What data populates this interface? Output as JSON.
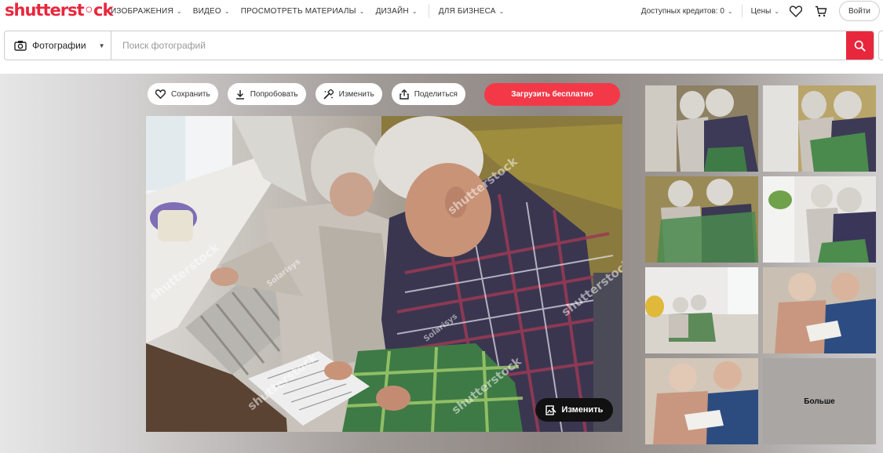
{
  "brand": {
    "logo_text": "shutterst◦ck",
    "accent": "#e8273d"
  },
  "nav": {
    "items": [
      {
        "label": "ИЗОБРАЖЕНИЯ"
      },
      {
        "label": "ВИДЕО"
      },
      {
        "label": "ПРОСМОТРЕТЬ МАТЕРИАЛЫ"
      },
      {
        "label": "ДИЗАЙН"
      },
      {
        "label": "ДЛЯ БИЗНЕСА"
      }
    ],
    "credits_label": "Доступных кредитов: 0",
    "prices_label": "Цены",
    "login_label": "Войти"
  },
  "search": {
    "type_label": "Фотографии",
    "placeholder": "Поиск фотографий"
  },
  "actions": {
    "save_label": "Сохранить",
    "try_label": "Попробовать",
    "edit_label": "Изменить",
    "share_label": "Поделиться",
    "download_label": "Загрузить бесплатно"
  },
  "photo": {
    "watermark_text": "shutterstock",
    "author_watermark": "Solarisys",
    "edit_overlay_label": "Изменить"
  },
  "similar": {
    "more_label": "Больше"
  }
}
